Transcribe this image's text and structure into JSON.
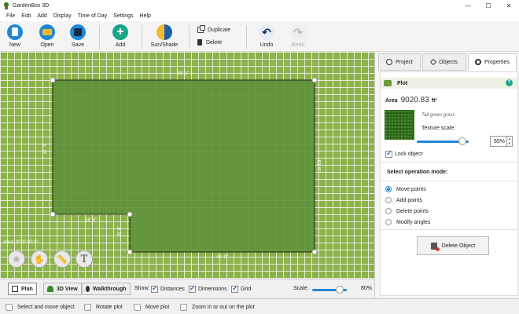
{
  "window": {
    "title": "GardenBox 3D",
    "controls": [
      "—",
      "☐",
      "✕"
    ]
  },
  "menu": [
    "File",
    "Edit",
    "Add",
    "Display",
    "Time of Day",
    "Settings",
    "Help"
  ],
  "toolbar": {
    "new": "New",
    "open": "Open",
    "save": "Save",
    "add": "Add",
    "sun_shade": "Sun/Shade",
    "duplicate": "Duplicate",
    "delete": "Delete",
    "undo": "Undo",
    "redo": "Redo"
  },
  "canvas": {
    "dims": {
      "top": "63' 1\"",
      "left": "37' 5\"",
      "right": "63' 5\"",
      "inner_top": "16' 4\"",
      "inner_vert": "16' 6\"",
      "bottom": "46' 9\""
    },
    "area_text": "Area: 9020.83 ft²",
    "float_buttons": [
      "shrubs-icon",
      "hand-icon",
      "ruler-icon",
      "text-icon"
    ],
    "text_tool_glyph": "T"
  },
  "viewbar": {
    "tabs": [
      "Plan",
      "3D View",
      "Walkthrough"
    ],
    "show_label": "Show:",
    "toggles": [
      {
        "label": "Distances",
        "checked": true
      },
      {
        "label": "Dimensions",
        "checked": true
      },
      {
        "label": "Grid",
        "checked": true
      }
    ],
    "scale_label": "Scale:",
    "scale_value": "80%",
    "scale_fraction": 0.8
  },
  "status": [
    "Select and move object",
    "Rotate plot",
    "Move plot",
    "Zoom in or out on the plot"
  ],
  "panel": {
    "tabs": [
      "Project",
      "Objects",
      "Properties"
    ],
    "active_tab": "Properties",
    "object_name": "Plot",
    "help": "?",
    "area_label": "Area",
    "area_value": "9020.83",
    "area_unit": "ft²",
    "texture_name": "Tall green grass",
    "texture_scale_label": "Texture scale:",
    "texture_scale_value": "65%",
    "texture_scale_fraction": 0.65,
    "lock_label": "Lock object",
    "mode_title": "Select operation mode:",
    "modes": [
      {
        "label": "Move points",
        "selected": true
      },
      {
        "label": "Add points",
        "selected": false
      },
      {
        "label": "Delete points",
        "selected": false
      },
      {
        "label": "Modify angles",
        "selected": false
      }
    ],
    "delete_button": "Delete Object"
  },
  "colors": {
    "accent": "#1e88d8",
    "grass": "#8db24c",
    "plot": "#5f913a",
    "add": "#1aa58a"
  }
}
